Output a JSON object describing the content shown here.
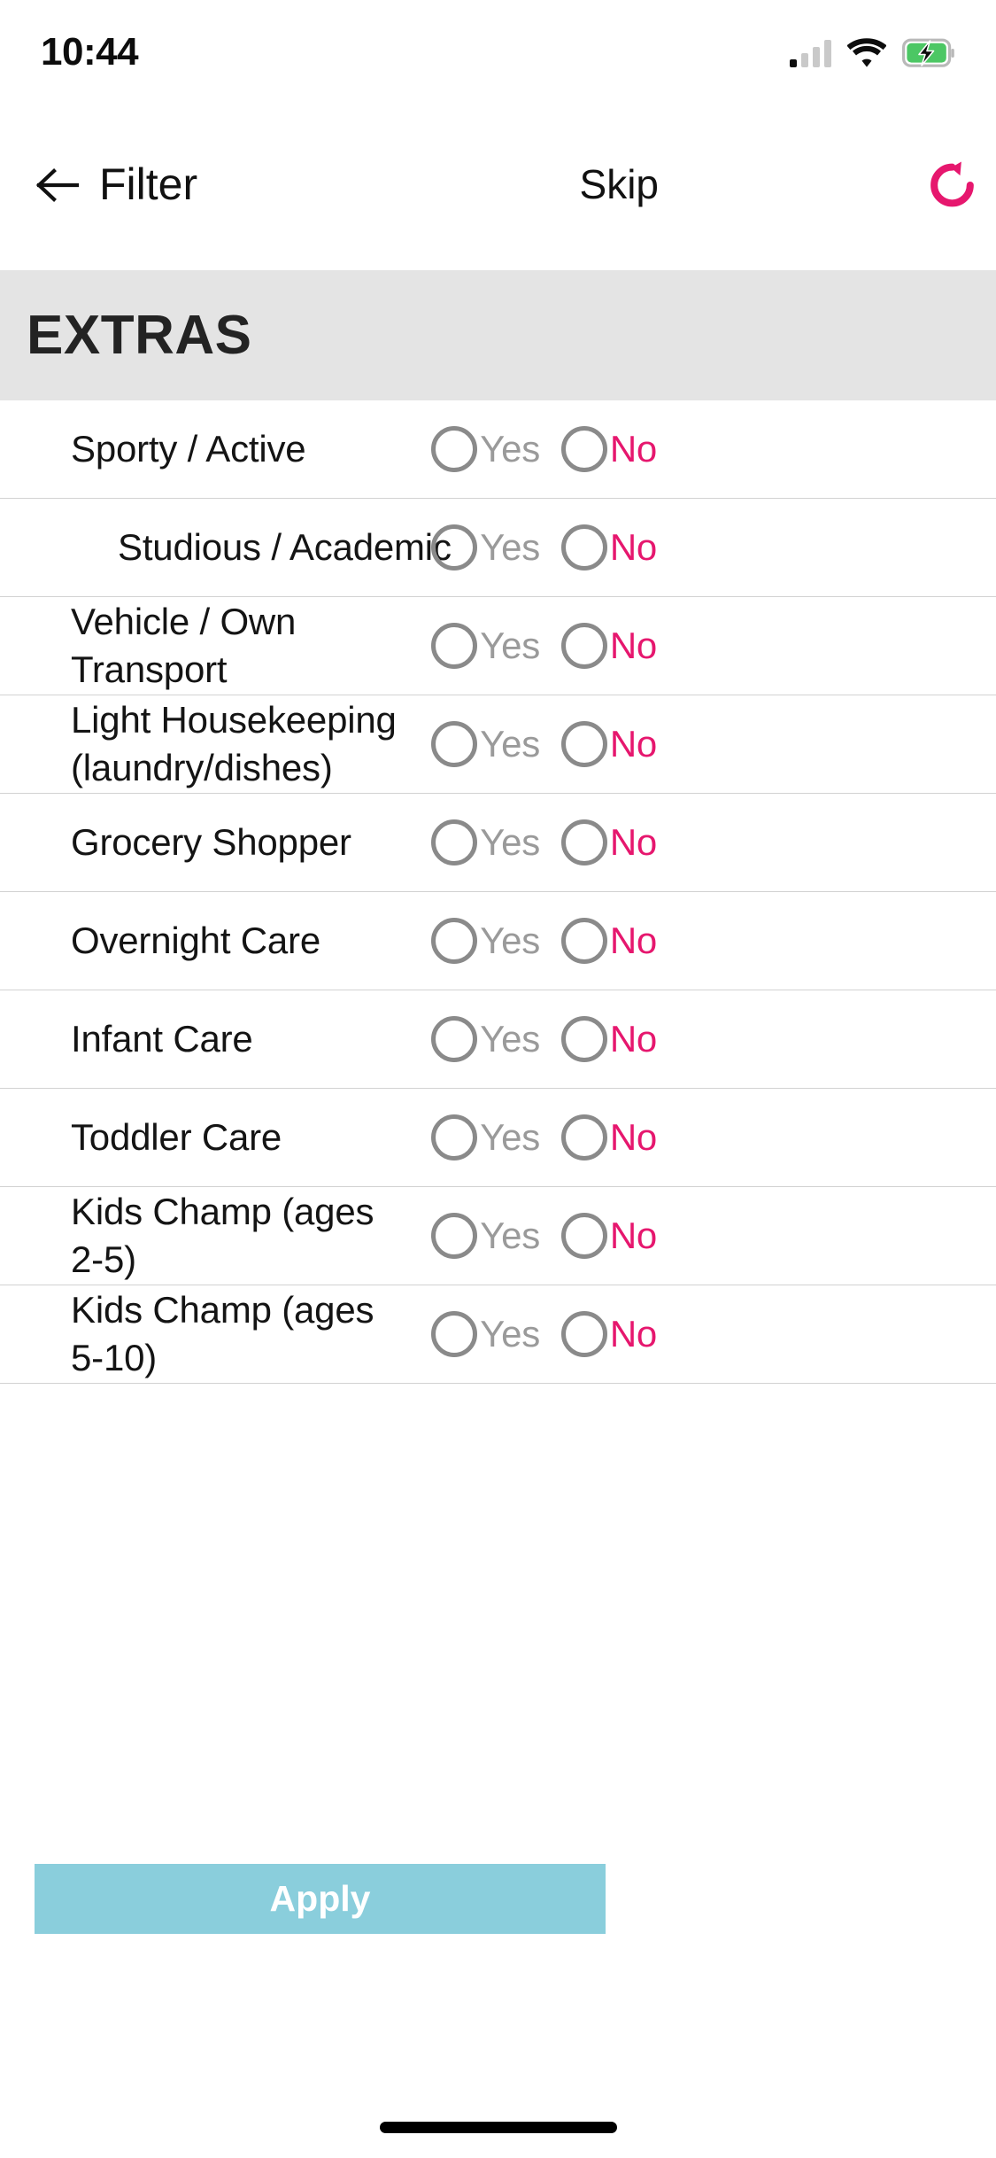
{
  "status_bar": {
    "time": "10:44",
    "signal_icon": "cellular-signal-icon",
    "signal_bars_total": 4,
    "signal_bars_active": 1,
    "wifi_icon": "wifi-icon",
    "battery_icon": "battery-charging-icon",
    "battery_color": "#4cc764"
  },
  "header": {
    "back_icon": "back-arrow-icon",
    "title": "Filter",
    "skip_label": "Skip",
    "reset_icon": "reset-refresh-icon",
    "reset_color": "#e6176e"
  },
  "section": {
    "title": "EXTRAS",
    "background": "#e4e4e4"
  },
  "options": {
    "yes_label": "Yes",
    "no_label": "No",
    "yes_color": "#9a9a9a",
    "no_color": "#e6176e",
    "radio_border_color": "#8a8a8a"
  },
  "rows": [
    {
      "label": "Sporty / Active",
      "label_line2": "",
      "indented": false,
      "selected": ""
    },
    {
      "label": "Studious / Academic",
      "label_line2": "",
      "indented": true,
      "selected": ""
    },
    {
      "label": "Vehicle / Own Transport",
      "label_line2": "",
      "indented": false,
      "selected": ""
    },
    {
      "label": "Light Housekeeping",
      "label_line2": "(laundry/dishes)",
      "indented": false,
      "selected": ""
    },
    {
      "label": "Grocery Shopper",
      "label_line2": "",
      "indented": false,
      "selected": ""
    },
    {
      "label": "Overnight Care",
      "label_line2": "",
      "indented": false,
      "selected": ""
    },
    {
      "label": "Infant Care",
      "label_line2": "",
      "indented": false,
      "selected": ""
    },
    {
      "label": "Toddler Care",
      "label_line2": "",
      "indented": false,
      "selected": ""
    },
    {
      "label": "Kids Champ (ages 2-5)",
      "label_line2": "",
      "indented": false,
      "selected": ""
    },
    {
      "label": "Kids Champ (ages 5-10)",
      "label_line2": "",
      "indented": false,
      "selected": ""
    }
  ],
  "footer": {
    "apply_label": "Apply",
    "apply_color": "#8acedc"
  }
}
